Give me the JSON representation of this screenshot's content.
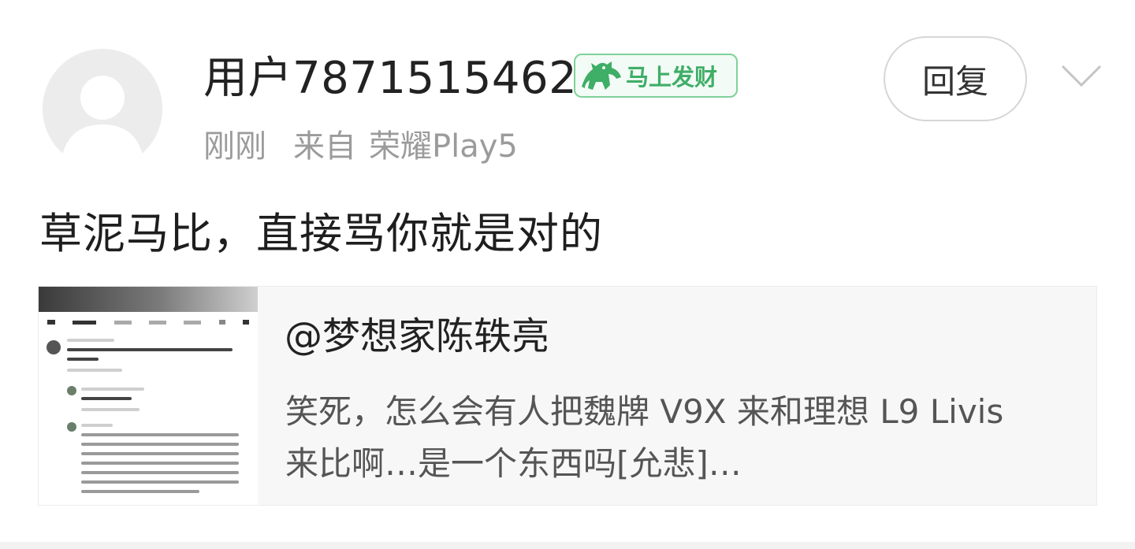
{
  "comment": {
    "username": "用户7871515462",
    "badge_label": "马上发财",
    "badge_icon": "horse-icon",
    "time": "刚刚",
    "source_prefix": "来自",
    "device": "荣耀Play5",
    "reply_label": "回复",
    "text": "草泥马比，直接骂你就是对的"
  },
  "quote": {
    "title": "@梦想家陈轶亮",
    "body_line1": "笑死，怎么会有人把魏牌 V9X 来和理想 L9 Livis",
    "body_line2": "来比啊…是一个东西吗[允悲]…"
  },
  "colors": {
    "badge_green": "#3fae67",
    "meta_gray": "#9b9b9b",
    "text_dark": "#1e1e1e",
    "card_bg": "#f7f7f7"
  }
}
